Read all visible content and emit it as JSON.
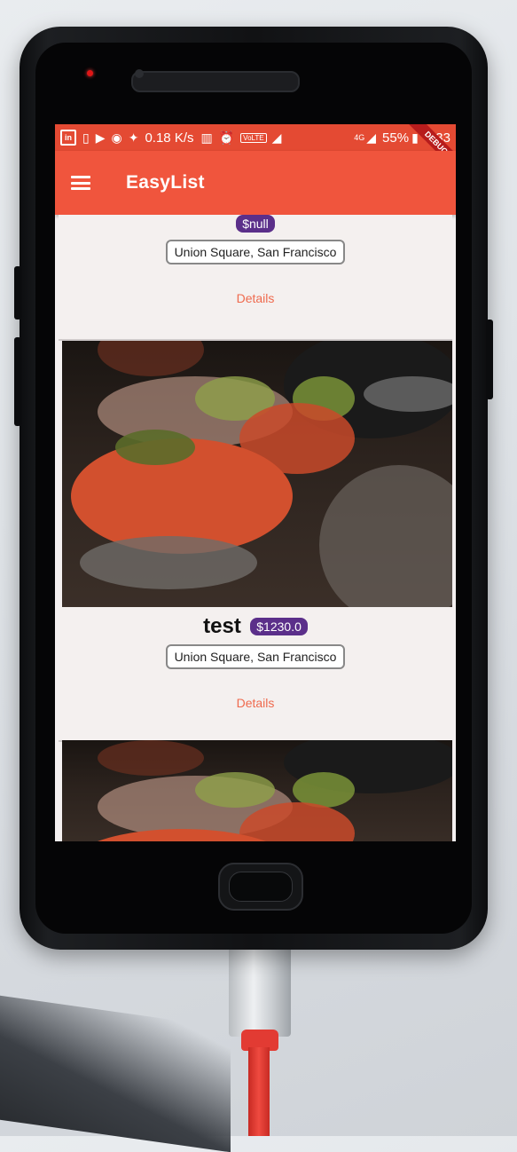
{
  "status_bar": {
    "network_speed": "0.18 K/s",
    "network_type": "4G",
    "volte_label": "VoLTE",
    "battery": "55%",
    "time": "3:33",
    "debug_label": "DEBUG"
  },
  "app_bar": {
    "title": "EasyList"
  },
  "products": [
    {
      "title": "",
      "price": "$null",
      "address": "Union Square, San Francisco",
      "details_label": "Details"
    },
    {
      "title": "test",
      "price": "$1230.0",
      "address": "Union Square, San Francisco",
      "details_label": "Details"
    }
  ],
  "colors": {
    "app_bar": "#f0553d",
    "status_bar": "#e44a33",
    "price_badge": "#5b2f8a",
    "details_text": "#ef6a4e",
    "cable": "#e23b33"
  }
}
